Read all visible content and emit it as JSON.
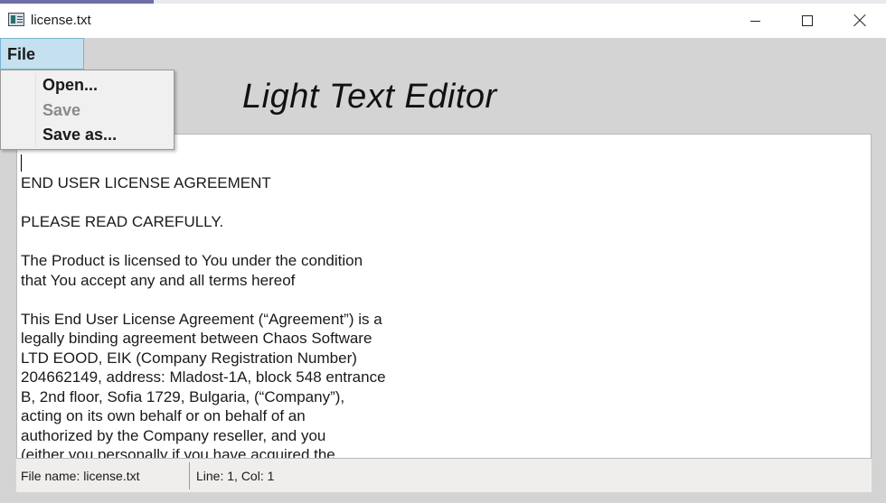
{
  "window": {
    "title": "license.txt",
    "icon": "notepad-icon"
  },
  "titlebar_buttons": {
    "minimize_icon": "minimize-icon",
    "maximize_icon": "maximize-icon",
    "close_icon": "close-icon"
  },
  "menu": {
    "file_label": "File",
    "items": [
      {
        "label": "Open...",
        "enabled": true
      },
      {
        "label": "Save",
        "enabled": false
      },
      {
        "label": "Save as...",
        "enabled": true
      }
    ]
  },
  "app": {
    "heading": "Light Text Editor"
  },
  "editor": {
    "paragraphs": [
      "END USER LICENSE AGREEMENT",
      "PLEASE READ CAREFULLY.",
      "The Product is licensed to You under the condition\nthat You accept any and all terms hereof",
      "This End User License Agreement (“Agreement”) is a\nlegally binding agreement between Chaos Software\nLTD EOOD, EIK (Company Registration Number)\n204662149, address: Mladost-1A, block 548 entrance\nB, 2nd floor, Sofia 1729, Bulgaria, (“Company”),\nacting on its own behalf or on behalf of an\nauthorized by the Company reseller, and you\n(either you personally if you have acquired the"
    ]
  },
  "status": {
    "file_name": "File name: license.txt",
    "position": "Line: 1, Col: 1"
  },
  "colors": {
    "menu_highlight": "#c5e0ee",
    "window_background": "#d4d4d4",
    "disabled_text": "#8a8a8a"
  }
}
